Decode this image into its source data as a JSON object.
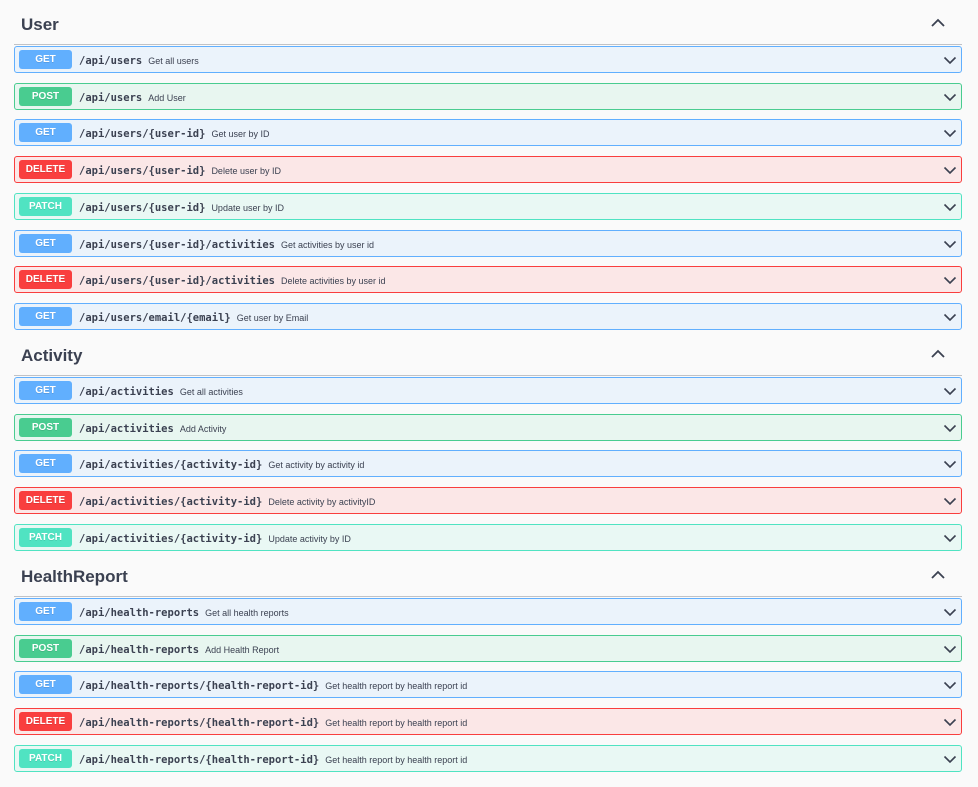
{
  "colors": {
    "get": "#61affe",
    "post": "#49cc90",
    "delete": "#f93e3e",
    "patch": "#50e3c2",
    "text": "#3b4151"
  },
  "icons": {
    "collapse": "chevron-up-icon",
    "expand": "chevron-down-icon"
  },
  "sections": [
    {
      "title": "User",
      "operations": [
        {
          "method": "GET",
          "path": "/api/users",
          "summary": "Get all users"
        },
        {
          "method": "POST",
          "path": "/api/users",
          "summary": "Add User"
        },
        {
          "method": "GET",
          "path": "/api/users/{user-id}",
          "summary": "Get user by ID"
        },
        {
          "method": "DELETE",
          "path": "/api/users/{user-id}",
          "summary": "Delete user by ID"
        },
        {
          "method": "PATCH",
          "path": "/api/users/{user-id}",
          "summary": "Update user by ID"
        },
        {
          "method": "GET",
          "path": "/api/users/{user-id}/activities",
          "summary": "Get activities by user id"
        },
        {
          "method": "DELETE",
          "path": "/api/users/{user-id}/activities",
          "summary": "Delete activities by user id"
        },
        {
          "method": "GET",
          "path": "/api/users/email/{email}",
          "summary": "Get user by Email"
        }
      ]
    },
    {
      "title": "Activity",
      "operations": [
        {
          "method": "GET",
          "path": "/api/activities",
          "summary": "Get all activities"
        },
        {
          "method": "POST",
          "path": "/api/activities",
          "summary": "Add Activity"
        },
        {
          "method": "GET",
          "path": "/api/activities/{activity-id}",
          "summary": "Get activity by activity id"
        },
        {
          "method": "DELETE",
          "path": "/api/activities/{activity-id}",
          "summary": "Delete activity by activityID"
        },
        {
          "method": "PATCH",
          "path": "/api/activities/{activity-id}",
          "summary": "Update activity by ID"
        }
      ]
    },
    {
      "title": "HealthReport",
      "operations": [
        {
          "method": "GET",
          "path": "/api/health-reports",
          "summary": "Get all health reports"
        },
        {
          "method": "POST",
          "path": "/api/health-reports",
          "summary": "Add Health Report"
        },
        {
          "method": "GET",
          "path": "/api/health-reports/{health-report-id}",
          "summary": "Get health report by health report id"
        },
        {
          "method": "DELETE",
          "path": "/api/health-reports/{health-report-id}",
          "summary": "Get health report by health report id"
        },
        {
          "method": "PATCH",
          "path": "/api/health-reports/{health-report-id}",
          "summary": "Get health report by health report id"
        }
      ]
    }
  ]
}
